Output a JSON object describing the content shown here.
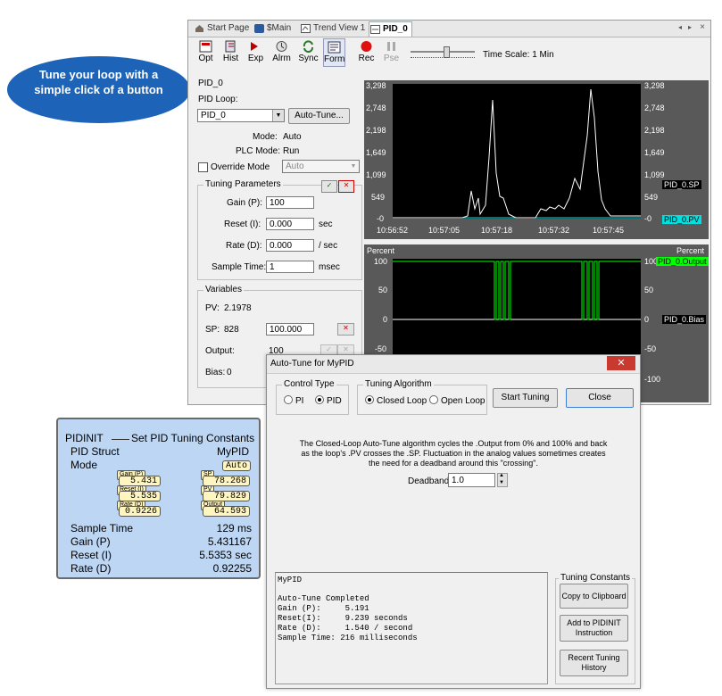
{
  "callout": {
    "text_line1": "Tune your loop with a",
    "text_line2": "simple click of a button"
  },
  "tabs": [
    {
      "label": "Start Page"
    },
    {
      "label": "$Main"
    },
    {
      "label": "Trend View 1"
    },
    {
      "label": "PID_0"
    }
  ],
  "toolbar": {
    "opt": "Opt",
    "hist": "Hist",
    "exp": "Exp",
    "alrm": "Alrm",
    "sync": "Sync",
    "form": "Form",
    "rec": "Rec",
    "pse": "Pse",
    "time_scale": "Time Scale: 1 Min"
  },
  "pid_panel": {
    "title": "PID_0",
    "loop_label": "PID Loop:",
    "loop_value": "PID_0",
    "autotune_button": "Auto-Tune...",
    "mode_label": "Mode:",
    "mode_value": "Auto",
    "plc_mode_label": "PLC Mode:",
    "plc_mode_value": "Run",
    "override_label": "Override Mode",
    "override_value": "Auto",
    "tuning_title": "Tuning Parameters",
    "gain_label": "Gain (P):",
    "gain_value": "100",
    "reset_label": "Reset (I):",
    "reset_value": "0.000",
    "reset_unit": "sec",
    "rate_label": "Rate (D):",
    "rate_value": "0.000",
    "rate_unit": "/ sec",
    "sample_label": "Sample Time:",
    "sample_value": "1",
    "sample_unit": "msec",
    "variables_title": "Variables",
    "pv_label": "PV:",
    "pv_value": "2.1978",
    "sp_label": "SP:",
    "sp_value": "828",
    "sp_input": "100.000",
    "output_label": "Output:",
    "output_value": "100",
    "bias_label": "Bias:",
    "bias_value": "0"
  },
  "trend": {
    "left_ticks": [
      "3,298",
      "2,748",
      "2,198",
      "1,649",
      "1,099",
      "549",
      "-0"
    ],
    "right_ticks": [
      "3,298",
      "2,748",
      "2,198",
      "1,649",
      "1,099",
      "549",
      "-0"
    ],
    "x_ticks": [
      "10:56:52",
      "10:57:05",
      "10:57:18",
      "10:57:32",
      "10:57:45"
    ],
    "legend_sp": "PID_0.SP",
    "legend_pv": "PID_0.PV",
    "out_left_title": "Percent",
    "out_right_title": "Percent",
    "out_left_ticks": [
      "100",
      "50",
      "0",
      "-50"
    ],
    "out_right_ticks": [
      "100",
      "50",
      "0",
      "-50",
      "-100"
    ],
    "legend_output": "PID_0.Output",
    "legend_bias": "PID_0.Bias",
    "sp_color": "#ffffff",
    "pv_color": "#00e0e0",
    "output_color": "#00ff00"
  },
  "pidinit": {
    "header_left": "PIDINIT",
    "header_right": "Set PID Tuning Constants",
    "struct_label": "PID Struct",
    "struct_value": "MyPID",
    "mode_label": "Mode",
    "mode_value": "Auto",
    "gain_tag": "Gain (P)",
    "gain_val": "5.431",
    "reset_tag": "Reset (I)",
    "reset_val": "5.535",
    "rate_tag": "Rate (D)",
    "rate_val": "0.9226",
    "sp_tag": "SP",
    "sp_val": "78.268",
    "pv_tag": "PV",
    "pv_val": "79.829",
    "output_tag": "Output",
    "output_val": "64.593",
    "rows": [
      {
        "label": "Sample Time",
        "value": "129 ms"
      },
      {
        "label": "Gain (P)",
        "value": "5.431167"
      },
      {
        "label": "Reset (I)",
        "value": "5.5353 sec"
      },
      {
        "label": "Rate (D)",
        "value": "0.92255"
      }
    ]
  },
  "dialog": {
    "title": "Auto-Tune for MyPID",
    "control_type_title": "Control Type",
    "pi_label": "PI",
    "pid_label": "PID",
    "algorithm_title": "Tuning Algorithm",
    "closed_loop_label": "Closed Loop",
    "open_loop_label": "Open Loop",
    "start_button": "Start Tuning",
    "close_button": "Close",
    "desc_line1": "The Closed-Loop Auto-Tune algorithm cycles the .Output from 0% and 100% and back",
    "desc_line2": "as the loop's .PV crosses the .SP.  Fluctuation in the analog values sometimes creates",
    "desc_line3": "the need for a deadband around this \"crossing\".",
    "deadband_label": "Deadband:",
    "deadband_value": "1.0",
    "results_title": "MyPID",
    "results": [
      "Auto-Tune Completed",
      "Gain (P):     5.191",
      "Reset(I):     9.239 seconds",
      "Rate (D):     1.540 / second",
      "Sample Time: 216 milliseconds"
    ],
    "constants_title": "Tuning Constants",
    "copy_button": "Copy to Clipboard",
    "add_button_l1": "Add to PIDINIT",
    "add_button_l2": "Instruction",
    "history_button_l1": "Recent Tuning",
    "history_button_l2": "History"
  }
}
